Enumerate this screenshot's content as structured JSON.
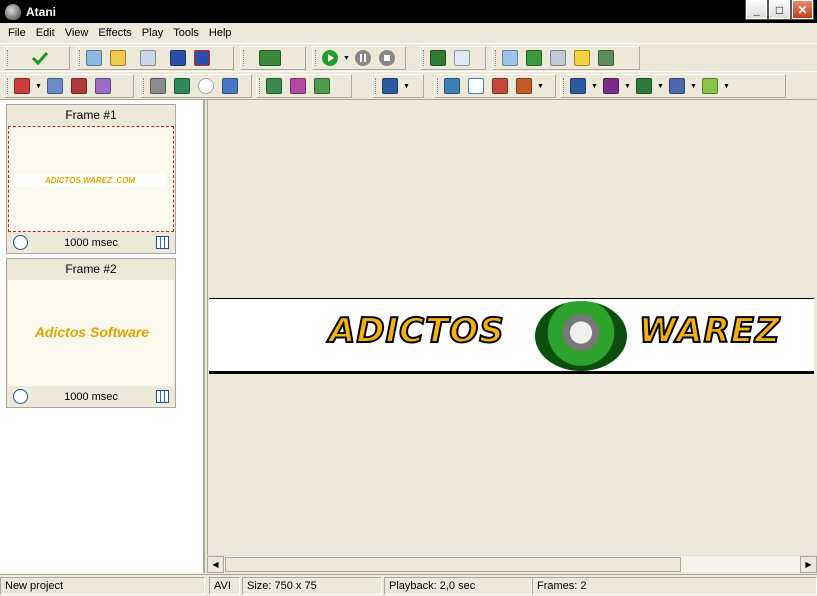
{
  "window": {
    "title": "Atani",
    "min_label": "_",
    "max_label": "□",
    "close_label": "✕"
  },
  "menu": [
    "File",
    "Edit",
    "View",
    "Effects",
    "Play",
    "Tools",
    "Help"
  ],
  "toolbar1": {
    "groups": [
      {
        "icons": [
          "check-icon"
        ]
      },
      {
        "icons": [
          "open-gif-icon",
          "open-folder-icon",
          "import-icon",
          "save-icon",
          "save-as-icon"
        ]
      },
      {
        "icons": [
          "save-all-icon"
        ]
      },
      {
        "icons": [
          "play-icon",
          "pause-icon",
          "stop-icon"
        ]
      },
      {
        "icons": [
          "disk-icon",
          "copy-icon"
        ]
      },
      {
        "icons": [
          "paint-icon",
          "lock-icon",
          "film-icon",
          "star-frame-icon",
          "picture-icon"
        ]
      }
    ]
  },
  "toolbar2": {
    "groups": [
      {
        "icons": [
          "add-frame-icon",
          "insert-frame-icon",
          "delete-frame-icon",
          "duplicate-frame-icon"
        ]
      },
      {
        "icons": [
          "move-up-icon",
          "move-down-icon",
          "timer-icon",
          "grid-icon"
        ]
      },
      {
        "icons": [
          "crop-icon",
          "resize-icon",
          "merge-icon"
        ]
      },
      {
        "icons": [
          "panel-icon"
        ]
      },
      {
        "icons": [
          "frames-icon",
          "select-icon",
          "layers-icon",
          "align-icon"
        ]
      },
      {
        "icons": [
          "effect-a-icon",
          "effect-b-icon",
          "effect-c-icon",
          "effect-d-icon",
          "effect-e-icon"
        ]
      }
    ]
  },
  "frames": [
    {
      "title": "Frame #1",
      "duration": "1000 msec",
      "thumb_text": "ADICTOS WAREZ .COM",
      "selected": true
    },
    {
      "title": "Frame #2",
      "duration": "1000 msec",
      "thumb_text": "Adictos Software",
      "selected": false
    }
  ],
  "canvas": {
    "banner_left": "ADICTOS",
    "banner_right": "WAREZ"
  },
  "status": {
    "project": "New project",
    "format": "AVI",
    "size": "Size: 750 x 75",
    "playback": "Playback: 2,0 sec",
    "frames": "Frames: 2"
  },
  "colors": {
    "title_bar": "#000000",
    "chrome": "#ece9d8",
    "banner_text": "#f5b20f",
    "selection": "#d02020"
  }
}
